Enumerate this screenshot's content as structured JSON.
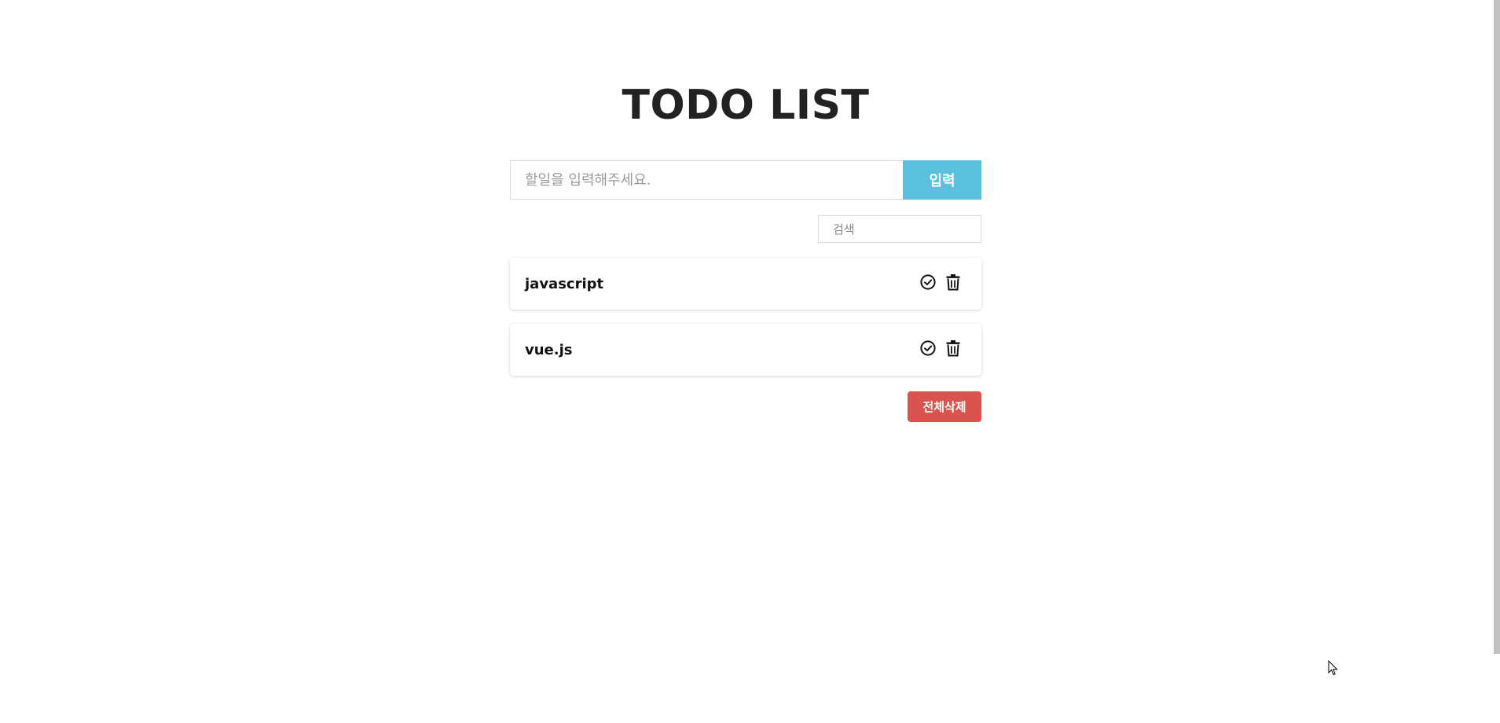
{
  "header": {
    "title": "TODO LIST"
  },
  "input": {
    "placeholder": "할일을 입력해주세요.",
    "value": "",
    "submit_label": "입력"
  },
  "search": {
    "placeholder": "검색",
    "value": ""
  },
  "todos": [
    {
      "text": "javascript"
    },
    {
      "text": "vue.js"
    }
  ],
  "footer": {
    "clear_all_label": "전체삭제"
  },
  "icons": {
    "complete": "check-circle-icon",
    "delete": "trash-icon"
  },
  "colors": {
    "submit_button": "#5bc0de",
    "clear_button": "#d9534f",
    "title": "#222222"
  }
}
